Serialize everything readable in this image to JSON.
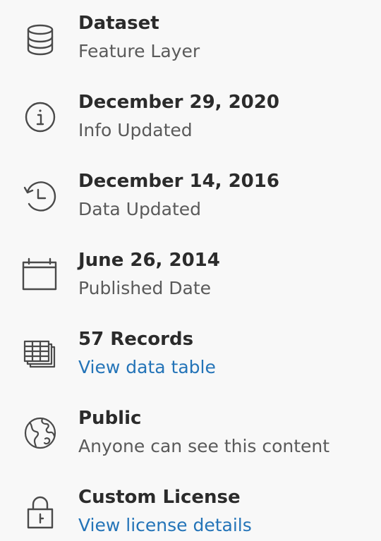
{
  "items": [
    {
      "icon": "database-icon",
      "title": "Dataset",
      "subtitle": "Feature Layer"
    },
    {
      "icon": "info-icon",
      "title": "December 29, 2020",
      "subtitle": "Info Updated"
    },
    {
      "icon": "history-icon",
      "title": "December 14, 2016",
      "subtitle": "Data Updated"
    },
    {
      "icon": "calendar-icon",
      "title": "June 26, 2014",
      "subtitle": "Published Date"
    },
    {
      "icon": "table-icon",
      "title": "57 Records",
      "subtitle": "View data table"
    },
    {
      "icon": "globe-icon",
      "title": "Public",
      "subtitle": "Anyone can see this content"
    },
    {
      "icon": "lock-icon",
      "title": "Custom License",
      "subtitle": "View license details"
    }
  ],
  "colors": {
    "background": "#f8f8f8",
    "title": "#2b2b2b",
    "subtitle": "#5a5a5a",
    "link": "#2474b8",
    "icon": "#4a4a4a"
  }
}
